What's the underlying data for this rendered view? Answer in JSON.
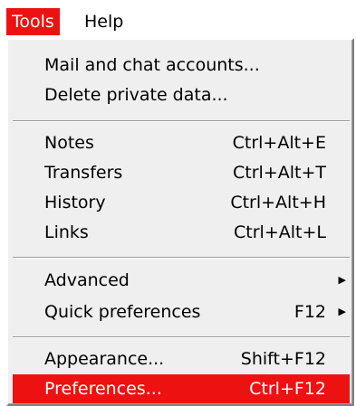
{
  "menubar": {
    "tools": "Tools",
    "help": "Help"
  },
  "menu": {
    "mail": "Mail and chat accounts...",
    "delete": "Delete private data...",
    "notes": {
      "label": "Notes",
      "shortcut": "Ctrl+Alt+E"
    },
    "transfers": {
      "label": "Transfers",
      "shortcut": "Ctrl+Alt+T"
    },
    "history": {
      "label": "History",
      "shortcut": "Ctrl+Alt+H"
    },
    "links": {
      "label": "Links",
      "shortcut": "Ctrl+Alt+L"
    },
    "advanced": {
      "label": "Advanced",
      "arrow": "▶"
    },
    "quickprefs": {
      "label": "Quick preferences",
      "shortcut": "F12",
      "arrow": "▶"
    },
    "appearance": {
      "label": "Appearance...",
      "shortcut": "Shift+F12"
    },
    "preferences": {
      "label": "Preferences...",
      "shortcut": "Ctrl+F12"
    }
  },
  "colors": {
    "highlight": "#ee1111",
    "menu_bg": "#efefef"
  }
}
